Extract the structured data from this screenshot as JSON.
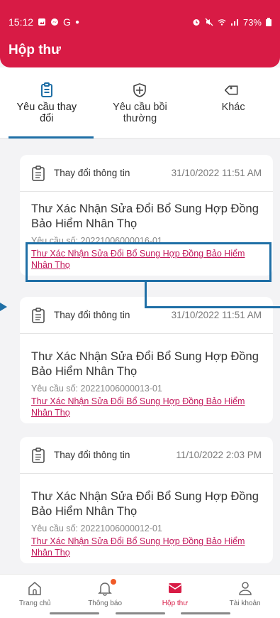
{
  "status_bar": {
    "time": "15:12",
    "battery": "73%"
  },
  "header": {
    "title": "Hộp thư"
  },
  "tabs": [
    {
      "label": "Yêu cầu thay đổi",
      "icon": "clipboard-icon",
      "active": true
    },
    {
      "label": "Yêu cầu bồi thường",
      "icon": "shield-icon",
      "active": false
    },
    {
      "label": "Khác",
      "icon": "tag-icon",
      "active": false
    }
  ],
  "cards": [
    {
      "type": "Thay đổi thông tin",
      "date": "31/10/2022 11:51 AM",
      "title": "Thư Xác Nhận Sửa Đổi Bổ Sung Hợp Đồng Bảo Hiểm Nhân Thọ",
      "request_no": "Yêu cầu số: 20221006000016-01",
      "link": "Thư Xác Nhận Sửa Đổi Bổ Sung Hợp Đồng Bảo Hiểm Nhân Thọ"
    },
    {
      "type": "Thay đổi thông tin",
      "date": "31/10/2022 11:51 AM",
      "title": "Thư Xác Nhận Sửa Đổi Bổ Sung Hợp Đồng Bảo Hiểm Nhân Thọ",
      "request_no": "Yêu cầu số: 20221006000013-01",
      "link": "Thư Xác Nhận Sửa Đổi Bổ Sung Hợp Đồng Bảo Hiểm Nhân Thọ"
    },
    {
      "type": "Thay đổi thông tin",
      "date": "11/10/2022 2:03 PM",
      "title": "Thư Xác Nhận Sửa Đổi Bổ Sung Hợp Đồng Bảo Hiểm Nhân Thọ",
      "request_no": "Yêu cầu số: 20221006000012-01",
      "link": "Thư Xác Nhận Sửa Đổi Bổ Sung Hợp Đồng Bảo Hiểm Nhân Thọ"
    }
  ],
  "bottom_nav": [
    {
      "label": "Trang chủ",
      "icon": "home-icon"
    },
    {
      "label": "Thông báo",
      "icon": "bell-icon"
    },
    {
      "label": "Hộp thư",
      "icon": "mail-icon",
      "active": true
    },
    {
      "label": "Tài khoản",
      "icon": "user-icon"
    }
  ],
  "colors": {
    "brand": "#d81b45",
    "accent": "#1f6fa6",
    "link": "#c2185b"
  }
}
